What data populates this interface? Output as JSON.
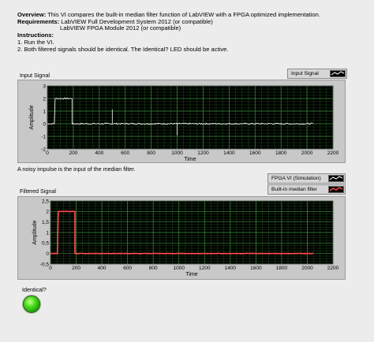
{
  "description": {
    "overview_label": "Overview:",
    "overview_text": " This VI compares the built-in median filter function of LabVIEW with a FPGA optimized implementation.",
    "requirements_label": "Requirements:",
    "requirements_line1": " LabVIEW Full Development System 2012 (or compatible)",
    "requirements_line2": "LabVIEW FPGA Module 2012 (or compatible)",
    "instructions_label": "Instructions:",
    "instruction_1": "1. Run the VI.",
    "instruction_2": "2. Both filtered signals should be identical. The Identical? LED should be active."
  },
  "input_graph": {
    "label": "Input Signal",
    "legend": [
      "Input Signal"
    ],
    "xlabel": "Time",
    "ylabel": "Amplitude"
  },
  "note": "A noisy impulse is the input of the median filter.",
  "filtered_graph": {
    "label": "Filtered Signal",
    "legend": [
      "FPGA VI (Simulation)",
      "Built-in median filter"
    ],
    "xlabel": "Time",
    "ylabel": "Amplitude"
  },
  "led": {
    "label": "Identical?",
    "state": "on",
    "color": "#3fd21b"
  },
  "chart_data": [
    {
      "type": "line",
      "title": "Input Signal",
      "xlabel": "Time",
      "ylabel": "Amplitude",
      "xlim": [
        0,
        2200
      ],
      "ylim": [
        -2,
        3
      ],
      "xticks": [
        0,
        200,
        400,
        600,
        800,
        1000,
        1200,
        1400,
        1600,
        1800,
        2000,
        2200
      ],
      "yticks": [
        -2,
        -1,
        0,
        1,
        2,
        3
      ],
      "grid": true,
      "series": [
        {
          "name": "Input Signal",
          "color": "#ffffff",
          "baseline": 0,
          "pulse": {
            "x_start": 60,
            "x_end": 190,
            "level": 2
          },
          "impulses": [
            {
              "x": 500,
              "y": 1.1
            },
            {
              "x": 1000,
              "y": -0.9
            }
          ],
          "x_end": 2048
        }
      ]
    },
    {
      "type": "line",
      "title": "Filtered Signal",
      "xlabel": "Time",
      "ylabel": "Amplitude",
      "xlim": [
        0,
        2200
      ],
      "ylim": [
        -0.5,
        2.5
      ],
      "xticks": [
        0,
        200,
        400,
        600,
        800,
        1000,
        1200,
        1400,
        1600,
        1800,
        2000,
        2200
      ],
      "yticks": [
        -0.5,
        0,
        0.5,
        1,
        1.5,
        2,
        2.5
      ],
      "grid": true,
      "series": [
        {
          "name": "FPGA VI (Simulation)",
          "color": "#ffffff",
          "baseline": 0,
          "pulse": {
            "x_start": 60,
            "x_end": 190,
            "level": 2
          },
          "x_end": 2048
        },
        {
          "name": "Built-in median filter",
          "color": "#ff4b4b",
          "baseline": 0,
          "pulse": {
            "x_start": 60,
            "x_end": 190,
            "level": 2
          },
          "x_end": 2048
        }
      ]
    }
  ]
}
